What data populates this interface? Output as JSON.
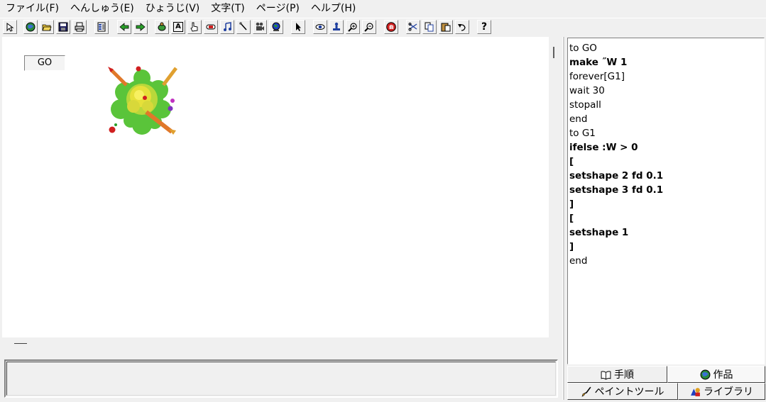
{
  "menu": [
    "ファイル(F)",
    "へんしゅう(E)",
    "ひょうじ(V)",
    "文字(T)",
    "ページ(P)",
    "ヘルプ(H)"
  ],
  "toolbar": {
    "help_label": "?",
    "text_tool_label": "A"
  },
  "canvas": {
    "go_button_label": "GO"
  },
  "code": [
    {
      "text": "to GO",
      "bold": false
    },
    {
      "text": "make ˝W 1",
      "bold": true
    },
    {
      "text": "forever[G1]",
      "bold": false
    },
    {
      "text": "wait 30",
      "bold": false
    },
    {
      "text": "stopall",
      "bold": false
    },
    {
      "text": "end",
      "bold": false
    },
    {
      "text": "to G1",
      "bold": false
    },
    {
      "text": "ifelse :W > 0",
      "bold": true
    },
    {
      "text": "[",
      "bold": true
    },
    {
      "text": "setshape 2 fd 0.1",
      "bold": true
    },
    {
      "text": "setshape 3 fd 0.1",
      "bold": true
    },
    {
      "text": "]",
      "bold": true
    },
    {
      "text": "[",
      "bold": true
    },
    {
      "text": "setshape 1",
      "bold": true
    },
    {
      "text": "]",
      "bold": true
    },
    {
      "text": "end",
      "bold": false
    }
  ],
  "tabs": {
    "procedures": "手順",
    "works": "作品",
    "paint_tool": "ペイントツール",
    "library": "ライブラリ"
  }
}
